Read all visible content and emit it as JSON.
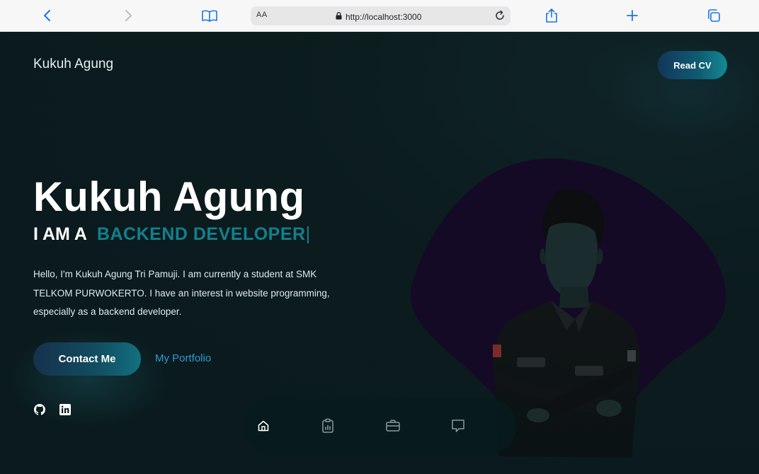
{
  "browser": {
    "aa_label": "AA",
    "url": "http://localhost:3000",
    "icons": [
      "back-arrow-icon",
      "forward-arrow-icon",
      "bookmarks-icon",
      "lock-icon",
      "reload-icon",
      "share-icon",
      "new-tab-icon",
      "tabs-icon"
    ]
  },
  "header": {
    "brand": "Kukuh Agung",
    "cv_label": "Read CV"
  },
  "hero": {
    "name": "Kukuh Agung",
    "role_prefix": "I AM A",
    "role_value": "BACKEND DEVELOPER",
    "bio": "Hello, I'm Kukuh Agung Tri Pamuji. I am currently a student at SMK TELKOM PURWOKERTO. I have an interest in website programming, especially as a backend developer.",
    "primary_cta": "Contact Me",
    "secondary_cta": "My Portfolio"
  },
  "social": {
    "icons": [
      "github-icon",
      "linkedin-icon"
    ]
  },
  "bottom_nav": {
    "icons": [
      "home-icon",
      "clipboard-chart-icon",
      "briefcase-icon",
      "chat-icon"
    ],
    "active": "home-icon"
  },
  "colors": {
    "background": "#0b1a1d",
    "accent": "#12808c",
    "link": "#2f9bd0",
    "blob": "#150a26"
  }
}
